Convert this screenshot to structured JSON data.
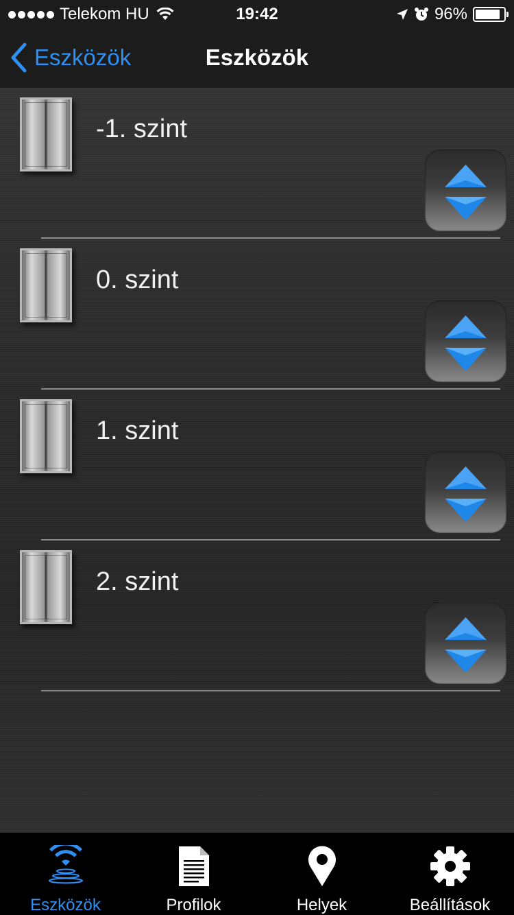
{
  "status_bar": {
    "carrier": "Telekom HU",
    "time": "19:42",
    "battery": "96%",
    "battery_level": 0.96
  },
  "nav": {
    "back_label": "Eszközök",
    "title": "Eszközök"
  },
  "levels": [
    {
      "label": "-1. szint"
    },
    {
      "label": "0. szint"
    },
    {
      "label": "1. szint"
    },
    {
      "label": "2. szint"
    }
  ],
  "tabs": [
    {
      "label": "Eszközök",
      "icon": "wifi-icon",
      "active": true
    },
    {
      "label": "Profilok",
      "icon": "document-icon",
      "active": false
    },
    {
      "label": "Helyek",
      "icon": "location-pin-icon",
      "active": false
    },
    {
      "label": "Beállítások",
      "icon": "gear-icon",
      "active": false
    }
  ],
  "colors": {
    "accent": "#2f8ff3",
    "arrow_blue": "#1f87e8"
  }
}
